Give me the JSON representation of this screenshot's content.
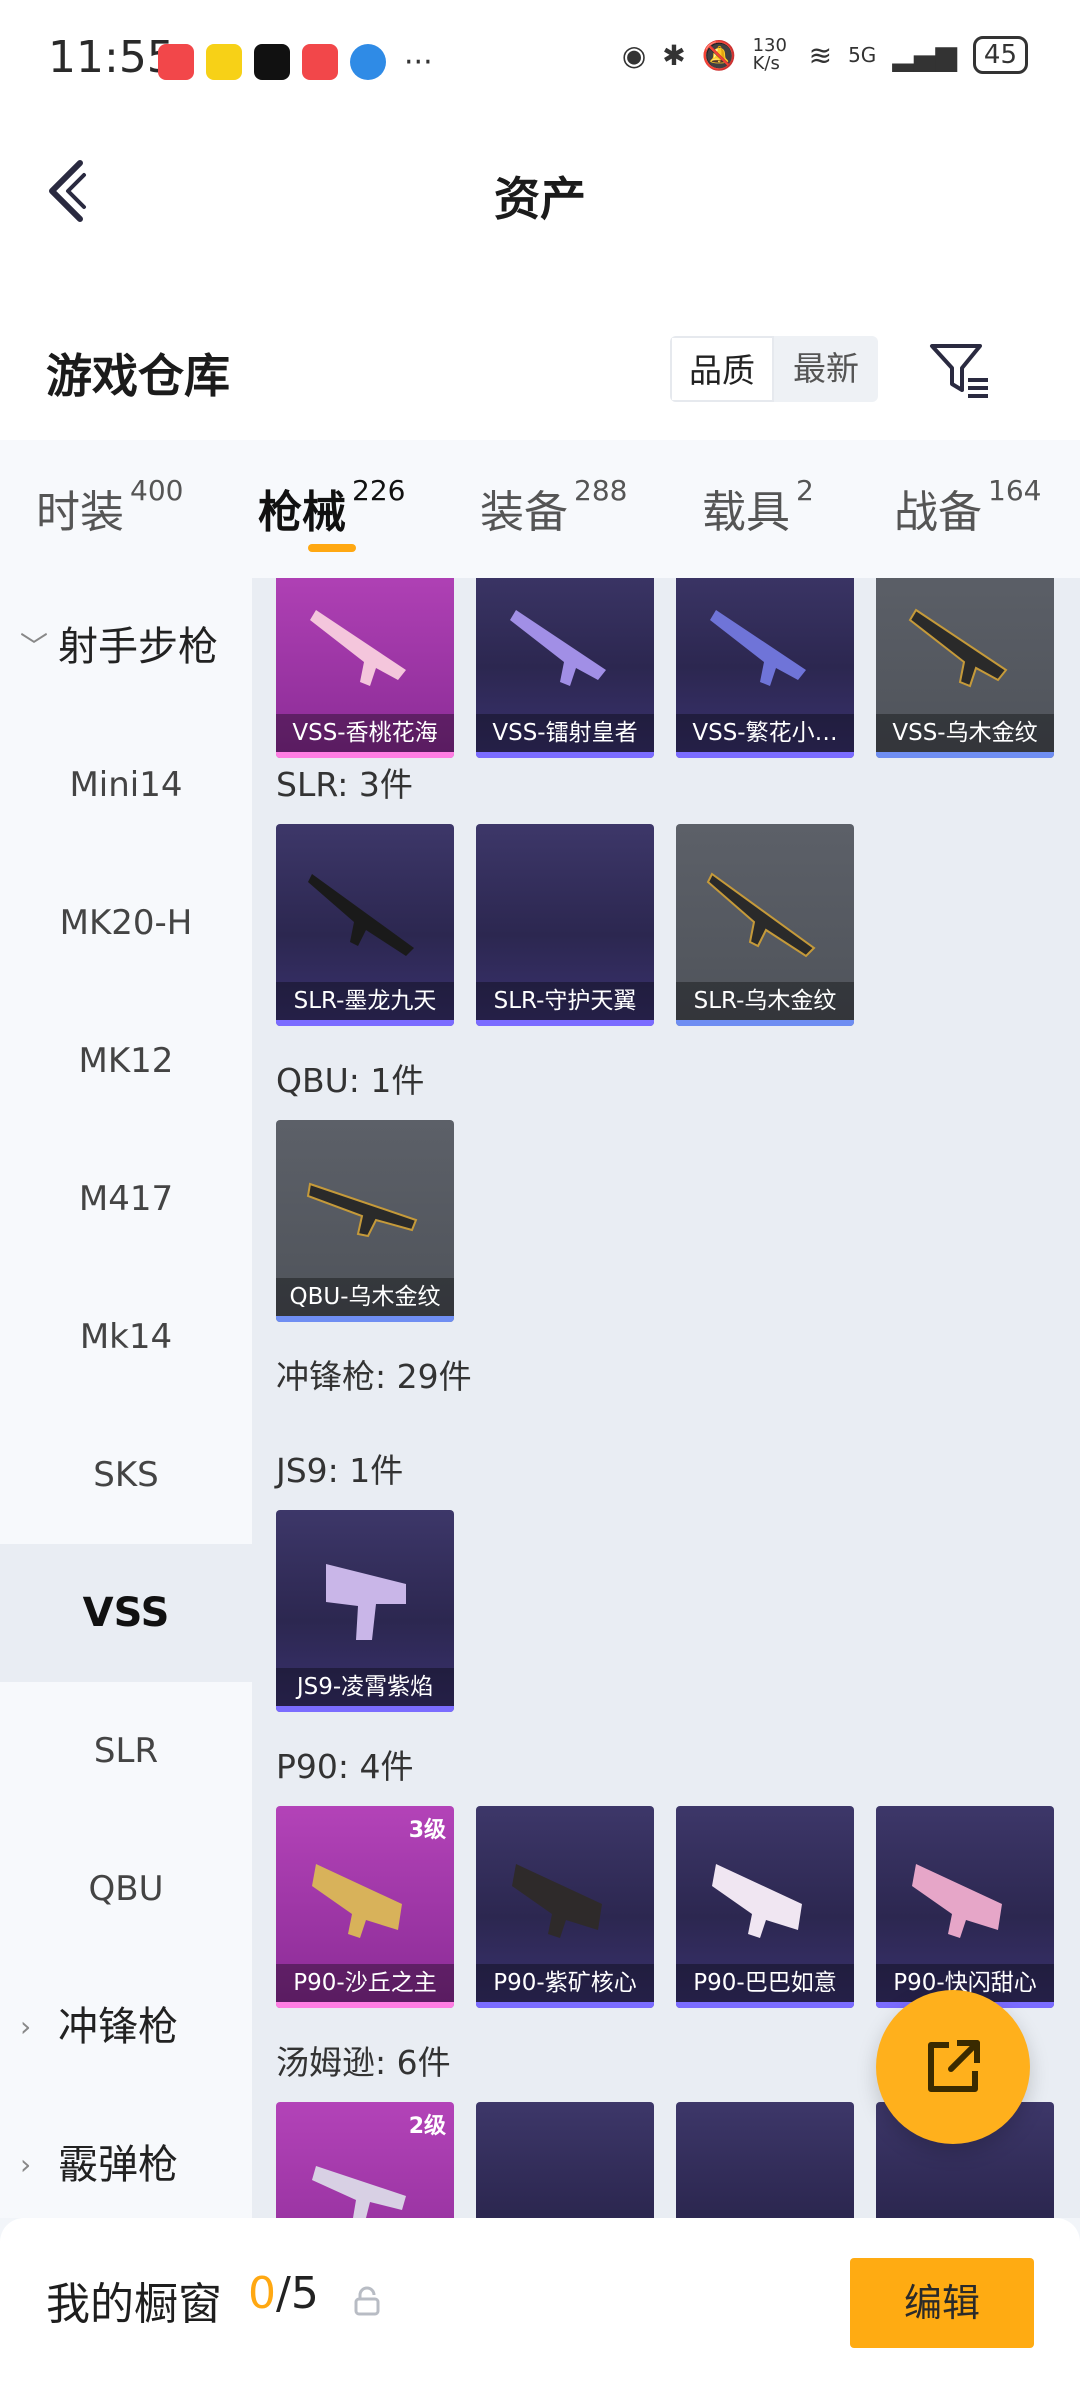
{
  "status_bar": {
    "time": "11:55",
    "net_speed": "130 K/s",
    "network": "5G",
    "battery": "45"
  },
  "header": {
    "title": "资产"
  },
  "warehouse": {
    "title": "游戏仓库",
    "sort_options": [
      "品质",
      "最新"
    ],
    "active_sort": "品质"
  },
  "tabs": [
    {
      "label": "时装",
      "count": "400"
    },
    {
      "label": "枪械",
      "count": "226"
    },
    {
      "label": "装备",
      "count": "288"
    },
    {
      "label": "载具",
      "count": "2"
    },
    {
      "label": "战备",
      "count": "164"
    }
  ],
  "active_tab": "枪械",
  "sidebar": {
    "group_open": "射手步枪",
    "items": [
      "Mini14",
      "MK20-H",
      "MK12",
      "M417",
      "Mk14",
      "SKS",
      "VSS",
      "SLR",
      "QBU"
    ],
    "active": "VSS",
    "groups_closed": [
      "冲锋枪",
      "霰弹枪"
    ]
  },
  "content": {
    "vss_cards": [
      "VSS-香桃花海",
      "VSS-镭射皇者",
      "VSS-繁花小…",
      "VSS-乌木金纹"
    ],
    "slr": {
      "label": "SLR: 3件",
      "cards": [
        "SLR-墨龙九天",
        "SLR-守护天翼",
        "SLR-乌木金纹"
      ]
    },
    "qbu": {
      "label": "QBU: 1件",
      "cards": [
        "QBU-乌木金纹"
      ]
    },
    "smg_label": "冲锋枪: 29件",
    "js9": {
      "label": "JS9: 1件",
      "cards": [
        "JS9-凌霄紫焰"
      ]
    },
    "p90": {
      "label": "P90: 4件",
      "cards": [
        "P90-沙丘之主",
        "P90-紫矿核心",
        "P90-巴巴如意",
        "P90-快闪甜心"
      ],
      "level": "3级"
    },
    "tommy": {
      "label": "汤姆逊: 6件",
      "level": "2级"
    }
  },
  "bottom_bar": {
    "title": "我的橱窗",
    "used": "0",
    "total": "/5",
    "edit_label": "编辑"
  },
  "colors": {
    "accent": "#ffa812",
    "card_purple": "#2c2750",
    "card_gray": "#52565d",
    "card_pink": "#9c34a6"
  }
}
